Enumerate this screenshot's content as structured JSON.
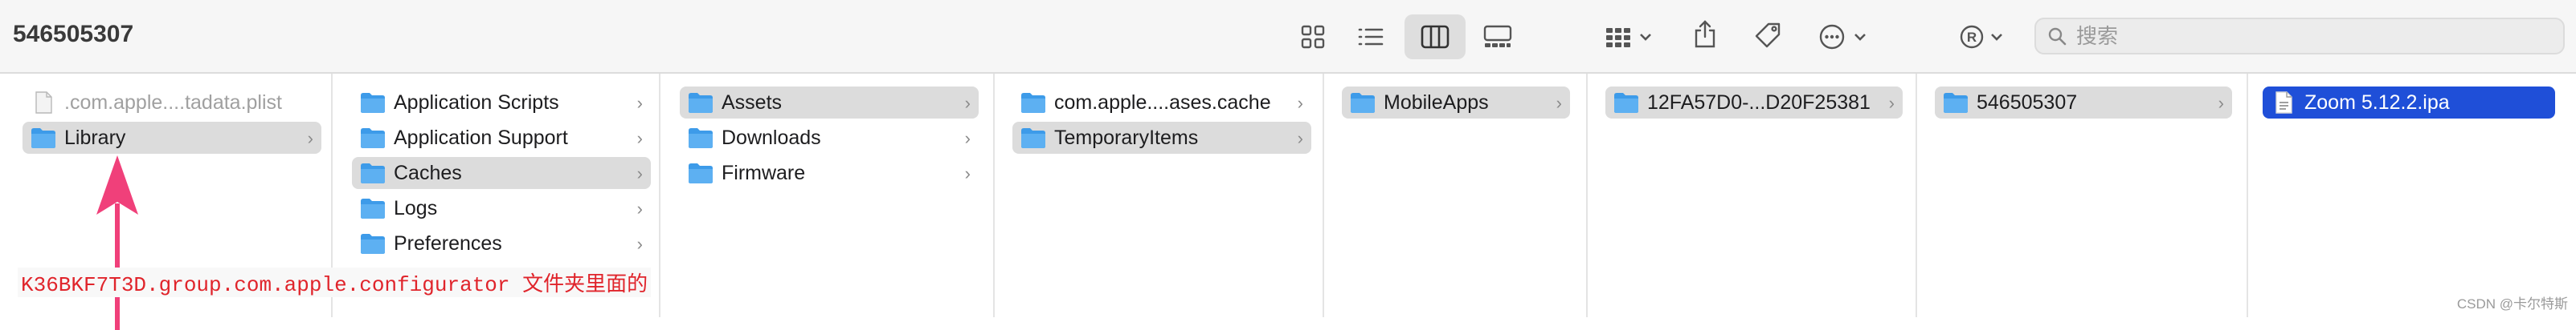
{
  "window": {
    "title": "546505307"
  },
  "search": {
    "placeholder": "搜索"
  },
  "toolbar": {
    "icons": [
      "grid-view-icon",
      "list-view-icon",
      "column-view-icon",
      "gallery-view-icon",
      "group-icon",
      "share-icon",
      "tag-icon",
      "more-icon",
      "finder-ext-icon",
      "search-icon"
    ],
    "selected_view": "column-view"
  },
  "columns": [
    {
      "items": [
        {
          "label": ".com.apple....tadata.plist",
          "type": "file",
          "state": "dim"
        },
        {
          "label": "Library",
          "type": "folder",
          "state": "selected",
          "chevron": true
        }
      ]
    },
    {
      "items": [
        {
          "label": "Application Scripts",
          "type": "folder",
          "chevron": true
        },
        {
          "label": "Application Support",
          "type": "folder",
          "chevron": true
        },
        {
          "label": "Caches",
          "type": "folder",
          "chevron": true,
          "state": "selected"
        },
        {
          "label": "Logs",
          "type": "folder",
          "chevron": true
        },
        {
          "label": "Preferences",
          "type": "folder",
          "chevron": true
        }
      ]
    },
    {
      "items": [
        {
          "label": "Assets",
          "type": "folder",
          "chevron": true,
          "state": "selected"
        },
        {
          "label": "Downloads",
          "type": "folder",
          "chevron": true
        },
        {
          "label": "Firmware",
          "type": "folder",
          "chevron": true
        }
      ]
    },
    {
      "items": [
        {
          "label": "com.apple....ases.cache",
          "type": "folder",
          "chevron": true
        },
        {
          "label": "TemporaryItems",
          "type": "folder",
          "chevron": true,
          "state": "selected"
        }
      ]
    },
    {
      "items": [
        {
          "label": "MobileApps",
          "type": "folder",
          "chevron": true,
          "state": "selected"
        }
      ]
    },
    {
      "items": [
        {
          "label": "12FA57D0-...D20F25381",
          "type": "folder",
          "chevron": true,
          "state": "selected"
        }
      ]
    },
    {
      "items": [
        {
          "label": "546505307",
          "type": "folder",
          "chevron": true,
          "state": "selected"
        }
      ]
    },
    {
      "items": [
        {
          "label": "Zoom 5.12.2.ipa",
          "type": "file",
          "state": "active"
        }
      ]
    }
  ],
  "annotation": {
    "text": "K36BKF7T3D.group.com.apple.configurator 文件夹里面的",
    "color": "#e0242b",
    "arrow_color": "#f0407a"
  },
  "watermark": "CSDN @卡尔特斯",
  "colors": {
    "folder": "#3d9be9",
    "selection_active": "#1f4fd8",
    "selection_inactive": "#dcdcdc"
  }
}
